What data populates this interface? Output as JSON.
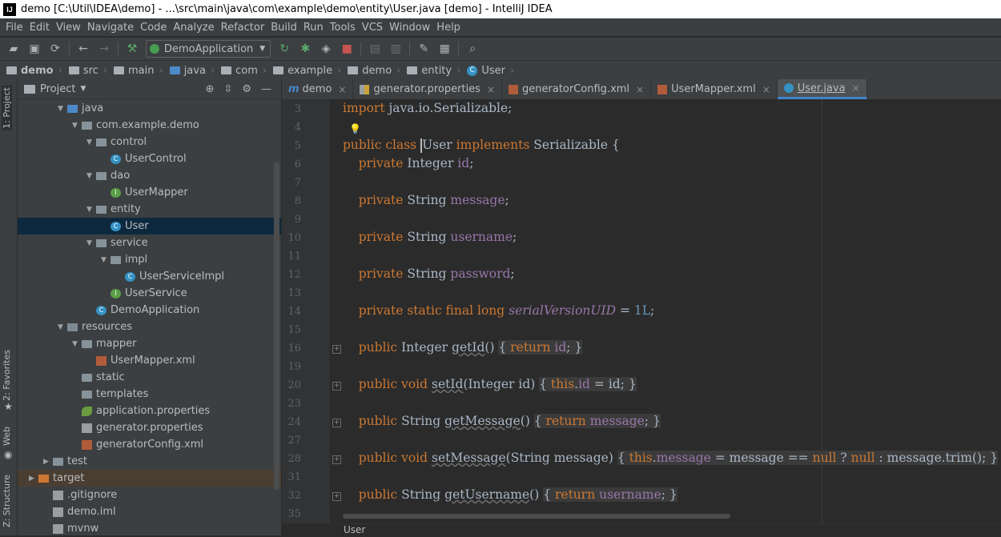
{
  "window": {
    "title": "demo [C:\\Util\\IDEA\\demo] - ...\\src\\main\\java\\com\\example\\demo\\entity\\User.java [demo] - IntelliJ IDEA",
    "logo": "IJ"
  },
  "menu": [
    "File",
    "Edit",
    "View",
    "Navigate",
    "Code",
    "Analyze",
    "Refactor",
    "Build",
    "Run",
    "Tools",
    "VCS",
    "Window",
    "Help"
  ],
  "toolbar": {
    "run_config": "DemoApplication",
    "icons": [
      "open-folder-icon",
      "save-icon",
      "sync-icon",
      "back-arrow-icon",
      "forward-arrow-icon",
      "build-hammer-icon",
      "rerun-icon",
      "debug-bug-icon",
      "coverage-icon",
      "stop-icon",
      "project-structure-icon",
      "sdk-icon",
      "wrench-icon",
      "folder-settings-icon",
      "search-everywhere-icon"
    ]
  },
  "breadcrumbs": [
    "demo",
    "src",
    "main",
    "java",
    "com",
    "example",
    "demo",
    "entity",
    "User"
  ],
  "left_strip": {
    "project": "1: Project",
    "favorites": "2: Favorites",
    "web": "Web",
    "structure": "Z: Structure"
  },
  "project_panel": {
    "title": "Project",
    "tree": [
      {
        "label": "java",
        "indent": 3,
        "arrow": "▼",
        "icon": "src"
      },
      {
        "label": "com.example.demo",
        "indent": 4,
        "arrow": "▼",
        "icon": "pkg"
      },
      {
        "label": "control",
        "indent": 5,
        "arrow": "▼",
        "icon": "pkg"
      },
      {
        "label": "UserControl",
        "indent": 6,
        "arrow": "",
        "icon": "cls"
      },
      {
        "label": "dao",
        "indent": 5,
        "arrow": "▼",
        "icon": "pkg"
      },
      {
        "label": "UserMapper",
        "indent": 6,
        "arrow": "",
        "icon": "iface"
      },
      {
        "label": "entity",
        "indent": 5,
        "arrow": "▼",
        "icon": "pkg"
      },
      {
        "label": "User",
        "indent": 6,
        "arrow": "",
        "icon": "cls",
        "selected": true
      },
      {
        "label": "service",
        "indent": 5,
        "arrow": "▼",
        "icon": "pkg"
      },
      {
        "label": "impl",
        "indent": 6,
        "arrow": "▼",
        "icon": "pkg"
      },
      {
        "label": "UserServiceImpl",
        "indent": 7,
        "arrow": "",
        "icon": "cls"
      },
      {
        "label": "UserService",
        "indent": 6,
        "arrow": "",
        "icon": "iface"
      },
      {
        "label": "DemoApplication",
        "indent": 5,
        "arrow": "",
        "icon": "app"
      },
      {
        "label": "resources",
        "indent": 3,
        "arrow": "▼",
        "icon": "res"
      },
      {
        "label": "mapper",
        "indent": 4,
        "arrow": "▼",
        "icon": "folder"
      },
      {
        "label": "UserMapper.xml",
        "indent": 5,
        "arrow": "",
        "icon": "xml"
      },
      {
        "label": "static",
        "indent": 4,
        "arrow": "",
        "icon": "folder"
      },
      {
        "label": "templates",
        "indent": 4,
        "arrow": "",
        "icon": "folder"
      },
      {
        "label": "application.properties",
        "indent": 4,
        "arrow": "",
        "icon": "leaf"
      },
      {
        "label": "generator.properties",
        "indent": 4,
        "arrow": "",
        "icon": "file"
      },
      {
        "label": "generatorConfig.xml",
        "indent": 4,
        "arrow": "",
        "icon": "xml"
      },
      {
        "label": "test",
        "indent": 2,
        "arrow": "▶",
        "icon": "folder"
      },
      {
        "label": "target",
        "indent": 1,
        "arrow": "▶",
        "icon": "target",
        "highlight": true
      },
      {
        "label": ".gitignore",
        "indent": 2,
        "arrow": "",
        "icon": "file"
      },
      {
        "label": "demo.iml",
        "indent": 2,
        "arrow": "",
        "icon": "file"
      },
      {
        "label": "mvnw",
        "indent": 2,
        "arrow": "",
        "icon": "file"
      }
    ]
  },
  "tabs": [
    {
      "label": "demo",
      "icon": "m"
    },
    {
      "label": "generator.properties",
      "icon": "props"
    },
    {
      "label": "generatorConfig.xml",
      "icon": "xml"
    },
    {
      "label": "UserMapper.xml",
      "icon": "xml"
    },
    {
      "label": "User.java",
      "icon": "cls",
      "active": true
    }
  ],
  "editor": {
    "lines": [
      {
        "n": "3",
        "fold": false,
        "html": "<span class='kw'>import</span> java.io.Serializable;"
      },
      {
        "n": "4",
        "fold": false,
        "html": ""
      },
      {
        "n": "5",
        "fold": false,
        "html": "<span class='kw'>public class</span> <span class='caret'></span>User <span class='kw'>implements</span> Serializable {"
      },
      {
        "n": "6",
        "fold": false,
        "html": "    <span class='kw'>private</span> Integer <span class='fld'>id</span>;"
      },
      {
        "n": "7",
        "fold": false,
        "html": ""
      },
      {
        "n": "8",
        "fold": false,
        "html": "    <span class='kw'>private</span> String <span class='fld'>message</span>;"
      },
      {
        "n": "9",
        "fold": false,
        "html": ""
      },
      {
        "n": "10",
        "fold": false,
        "html": "    <span class='kw'>private</span> String <span class='fld'>username</span>;"
      },
      {
        "n": "11",
        "fold": false,
        "html": ""
      },
      {
        "n": "12",
        "fold": false,
        "html": "    <span class='kw'>private</span> String <span class='fld'>password</span>;"
      },
      {
        "n": "13",
        "fold": false,
        "html": ""
      },
      {
        "n": "14",
        "fold": false,
        "html": "    <span class='kw'>private static final long</span> <span class='it'>serialVersionUID</span> = <span class='num'>1L</span>;"
      },
      {
        "n": "15",
        "fold": false,
        "html": ""
      },
      {
        "n": "16",
        "fold": true,
        "html": "    <span class='kw'>public</span> Integer <span class='mth'>getId</span>() <span class='brace'>{ <span class='kw'>return</span> <span class='fld'>id</span>; }</span>"
      },
      {
        "n": "19",
        "fold": false,
        "html": ""
      },
      {
        "n": "20",
        "fold": true,
        "html": "    <span class='kw'>public void</span> <span class='mth'>setId</span>(Integer id) <span class='brace'>{ <span class='kw'>this</span>.<span class='fld'>id</span> = id; }</span>"
      },
      {
        "n": "23",
        "fold": false,
        "html": ""
      },
      {
        "n": "24",
        "fold": true,
        "html": "    <span class='kw'>public</span> String <span class='mth'>getMessage</span>() <span class='brace'>{ <span class='kw'>return</span> <span class='fld'>message</span>; }</span>"
      },
      {
        "n": "27",
        "fold": false,
        "html": ""
      },
      {
        "n": "28",
        "fold": true,
        "html": "    <span class='kw'>public void</span> <span class='mth'>setMessage</span>(String message) <span class='brace'>{ <span class='kw'>this</span>.<span class='fld'>message</span> = message == <span class='kw'>null</span> ? <span class='kw'>null</span> : message.trim(); }</span>"
      },
      {
        "n": "31",
        "fold": false,
        "html": ""
      },
      {
        "n": "32",
        "fold": true,
        "html": "    <span class='kw'>public</span> String <span class='mth'>getUsername</span>() <span class='brace'>{ <span class='kw'>return</span> <span class='fld'>username</span>; }</span>"
      },
      {
        "n": "35",
        "fold": false,
        "html": ""
      }
    ]
  },
  "status_breadcrumb": "User"
}
